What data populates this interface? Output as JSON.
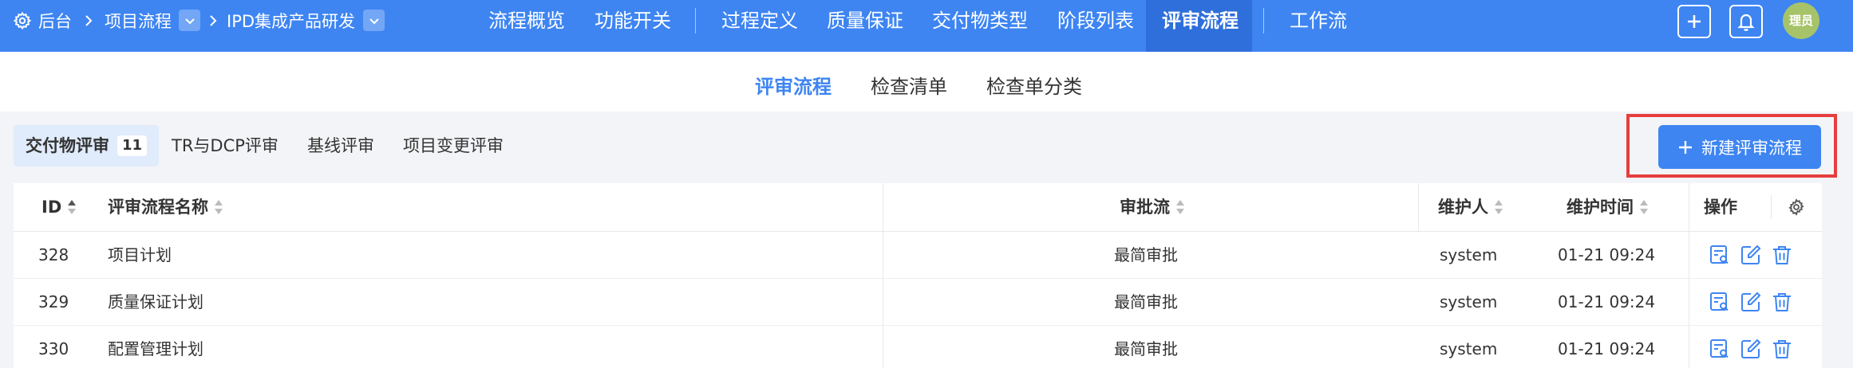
{
  "topbar": {
    "breadcrumb": {
      "home": "后台",
      "project": "项目流程",
      "product": "IPD集成产品研发"
    },
    "nav": [
      "流程概览",
      "功能开关",
      "过程定义",
      "质量保证",
      "交付物类型",
      "阶段列表",
      "评审流程",
      "工作流"
    ],
    "active_nav": "评审流程",
    "avatar_text": "理员"
  },
  "subtabs": {
    "items": [
      "评审流程",
      "检查清单",
      "检查单分类"
    ],
    "active": "评审流程"
  },
  "review_tabs": {
    "items": [
      {
        "label": "交付物评审",
        "count": "11"
      },
      {
        "label": "TR与DCP评审"
      },
      {
        "label": "基线评审"
      },
      {
        "label": "项目变更评审"
      }
    ]
  },
  "new_button_label": "新建评审流程",
  "table": {
    "headers": {
      "id": "ID",
      "name": "评审流程名称",
      "approval": "审批流",
      "maintainer": "维护人",
      "time": "维护时间",
      "actions": "操作"
    },
    "rows": [
      {
        "id": "328",
        "name": "项目计划",
        "approval": "最简审批",
        "maintainer": "system",
        "time": "01-21 09:24"
      },
      {
        "id": "329",
        "name": "质量保证计划",
        "approval": "最简审批",
        "maintainer": "system",
        "time": "01-21 09:24"
      },
      {
        "id": "330",
        "name": "配置管理计划",
        "approval": "最简审批",
        "maintainer": "system",
        "time": "01-21 09:24"
      }
    ]
  },
  "colors": {
    "primary": "#3e85f2",
    "active_nav_bg": "#2f6fdb",
    "highlight_border": "#e63e3e",
    "avatar": "#a7c36a"
  },
  "icons": [
    "gear-icon",
    "chevron-right-icon",
    "chevron-down-icon",
    "plus-icon",
    "bell-icon",
    "sort-icon",
    "settings-icon",
    "view-icon",
    "edit-icon",
    "delete-icon"
  ]
}
